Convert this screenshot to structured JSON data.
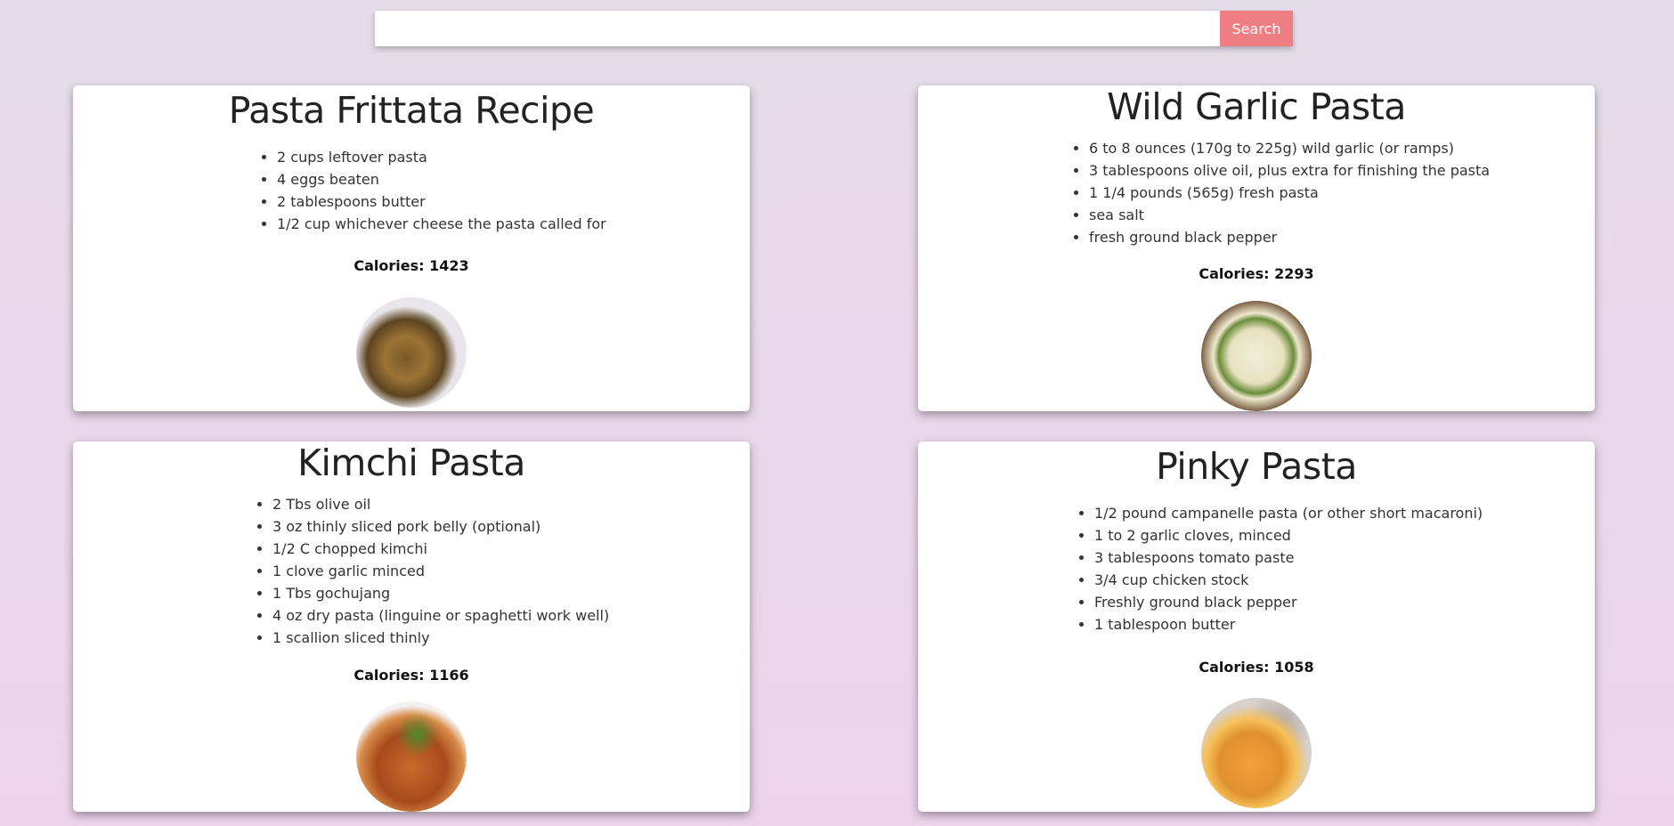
{
  "search": {
    "value": "",
    "placeholder": "",
    "button_label": "Search"
  },
  "recipes": [
    {
      "title": "Pasta Frittata Recipe",
      "ingredients": [
        "2 cups leftover pasta",
        "4 eggs beaten",
        "2 tablespoons butter",
        "1/2 cup whichever cheese the pasta called for"
      ],
      "calories": "Calories: 1423"
    },
    {
      "title": "Wild Garlic Pasta",
      "ingredients": [
        "6 to 8 ounces (170g to 225g) wild garlic (or ramps)",
        "3 tablespoons olive oil, plus extra for finishing the pasta",
        "1 1/4 pounds (565g) fresh pasta",
        "sea salt",
        "fresh ground black pepper"
      ],
      "calories": "Calories: 2293"
    },
    {
      "title": "Kimchi Pasta",
      "ingredients": [
        "2 Tbs olive oil",
        "3 oz thinly sliced pork belly (optional)",
        "1/2 C chopped kimchi",
        "1 clove garlic minced",
        "1 Tbs gochujang",
        "4 oz dry pasta (linguine or spaghetti work well)",
        "1 scallion sliced thinly"
      ],
      "calories": "Calories: 1166"
    },
    {
      "title": "Pinky Pasta",
      "ingredients": [
        "1/2 pound campanelle pasta (or other short macaroni)",
        "1 to 2 garlic cloves, minced",
        "3 tablespoons tomato paste",
        "3/4 cup chicken stock",
        "Freshly ground black pepper",
        "1 tablespoon butter"
      ],
      "calories": "Calories: 1058"
    }
  ]
}
